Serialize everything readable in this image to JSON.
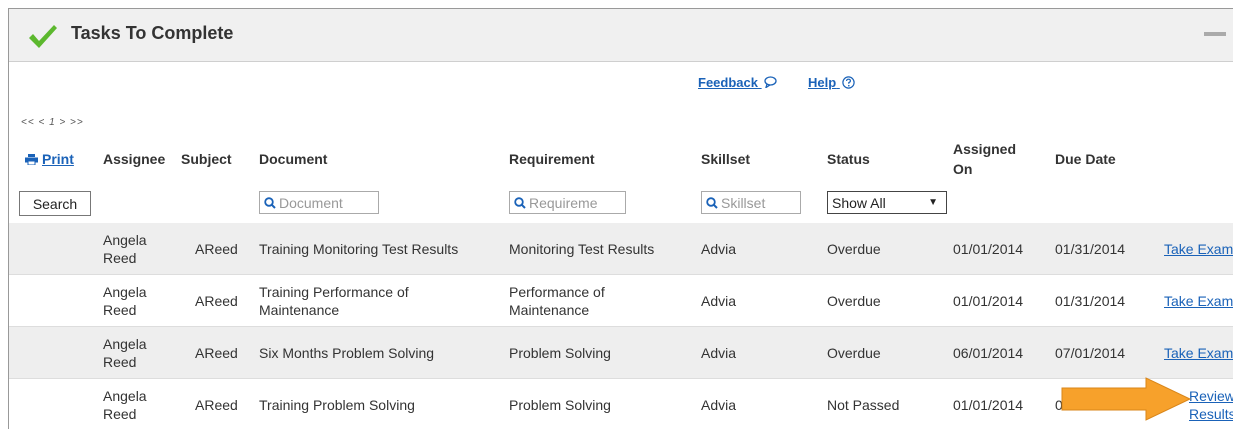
{
  "panel": {
    "title": "Tasks To Complete",
    "check_icon": "check-icon",
    "minimize_icon": "minimize-icon",
    "accent_color": "#5cb82e"
  },
  "links": {
    "feedback": "Feedback",
    "help": "Help"
  },
  "pager": "<< < 1 > >>",
  "toolbar": {
    "print_label": "Print",
    "search_label": "Search"
  },
  "columns": [
    "Assignee",
    "Subject",
    "Document",
    "Requirement",
    "Skillset",
    "Status",
    "Assigned On",
    "Due Date"
  ],
  "filters": {
    "document_placeholder": "Document",
    "requirement_placeholder": "Requireme",
    "skillset_placeholder": "Skillset",
    "status_value": "Show All"
  },
  "rows": [
    {
      "assignee": "Angela Reed",
      "subject": "AReed",
      "document": "Training Monitoring Test Results",
      "requirement": "Monitoring Test Results",
      "skillset": "Advia",
      "status": "Overdue",
      "assigned_on": "01/01/2014",
      "due_date": "01/31/2014",
      "action": "Take Exam"
    },
    {
      "assignee": "Angela Reed",
      "subject": "AReed",
      "document": "Training Performance of Maintenance",
      "requirement": "Performance of Maintenance",
      "skillset": "Advia",
      "status": "Overdue",
      "assigned_on": "01/01/2014",
      "due_date": "01/31/2014",
      "action": "Take Exam"
    },
    {
      "assignee": "Angela Reed",
      "subject": "AReed",
      "document": "Six Months Problem Solving",
      "requirement": "Problem Solving",
      "skillset": "Advia",
      "status": "Overdue",
      "assigned_on": "06/01/2014",
      "due_date": "07/01/2014",
      "action": "Take Exam"
    },
    {
      "assignee": "Angela Reed",
      "subject": "AReed",
      "document": "Training Problem Solving",
      "requirement": "Problem Solving",
      "skillset": "Advia",
      "status": "Not Passed",
      "assigned_on": "01/01/2014",
      "due_date": "01",
      "action": "Review Results"
    }
  ],
  "annotation": {
    "arrow_icon": "arrow-icon",
    "arrow_color": "#f7a12b"
  }
}
